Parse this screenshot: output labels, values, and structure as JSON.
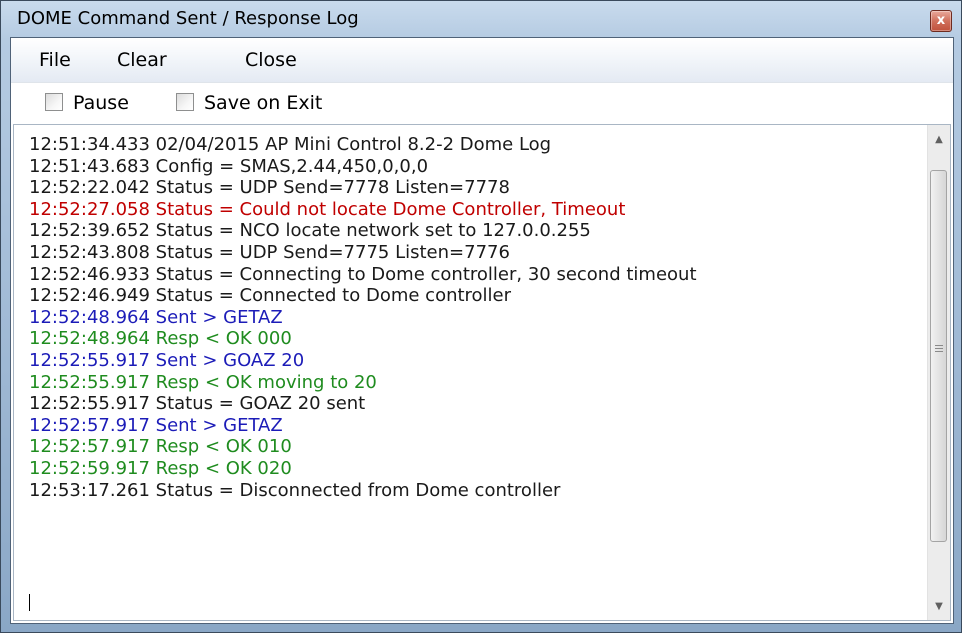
{
  "window": {
    "title": "DOME Command Sent / Response Log",
    "close_glyph": "x"
  },
  "menu": {
    "file": "File",
    "clear": "Clear",
    "close": "Close"
  },
  "options": {
    "pause_label": "Pause",
    "pause_checked": false,
    "save_on_exit_label": "Save on Exit",
    "save_on_exit_checked": false
  },
  "colors": {
    "status": "#1a1a1a",
    "error": "#c00000",
    "sent": "#1c1cb8",
    "response": "#1f8c1f"
  },
  "log": [
    {
      "text": "12:51:34.433  02/04/2015 AP Mini Control 8.2-2 Dome Log",
      "kind": "black"
    },
    {
      "text": "12:51:43.683  Config = SMAS,2.44,450,0,0,0",
      "kind": "black"
    },
    {
      "text": "12:52:22.042  Status = UDP Send=7778 Listen=7778",
      "kind": "black"
    },
    {
      "text": "12:52:27.058  Status = Could not locate Dome Controller, Timeout",
      "kind": "red"
    },
    {
      "text": "12:52:39.652  Status = NCO locate network set to 127.0.0.255",
      "kind": "black"
    },
    {
      "text": "12:52:43.808  Status = UDP Send=7775 Listen=7776",
      "kind": "black"
    },
    {
      "text": "12:52:46.933  Status = Connecting to Dome controller, 30 second timeout",
      "kind": "black"
    },
    {
      "text": "12:52:46.949  Status = Connected to Dome controller",
      "kind": "black"
    },
    {
      "text": "12:52:48.964  Sent > GETAZ",
      "kind": "blue"
    },
    {
      "text": "12:52:48.964  Resp < OK 000",
      "kind": "green"
    },
    {
      "text": "12:52:55.917  Sent > GOAZ 20",
      "kind": "blue"
    },
    {
      "text": "12:52:55.917  Resp < OK moving to 20",
      "kind": "green"
    },
    {
      "text": "12:52:55.917  Status = GOAZ 20 sent",
      "kind": "black"
    },
    {
      "text": "12:52:57.917  Sent > GETAZ",
      "kind": "blue"
    },
    {
      "text": "12:52:57.917  Resp < OK 010",
      "kind": "green"
    },
    {
      "text": "12:52:59.917  Resp < OK 020",
      "kind": "green"
    },
    {
      "text": "12:53:17.261  Status = Disconnected from Dome controller",
      "kind": "black"
    }
  ],
  "scrollbar": {
    "up_icon": "scroll-up-arrow-icon",
    "down_icon": "scroll-down-arrow-icon",
    "grip_icon": "scroll-grip-icon"
  }
}
